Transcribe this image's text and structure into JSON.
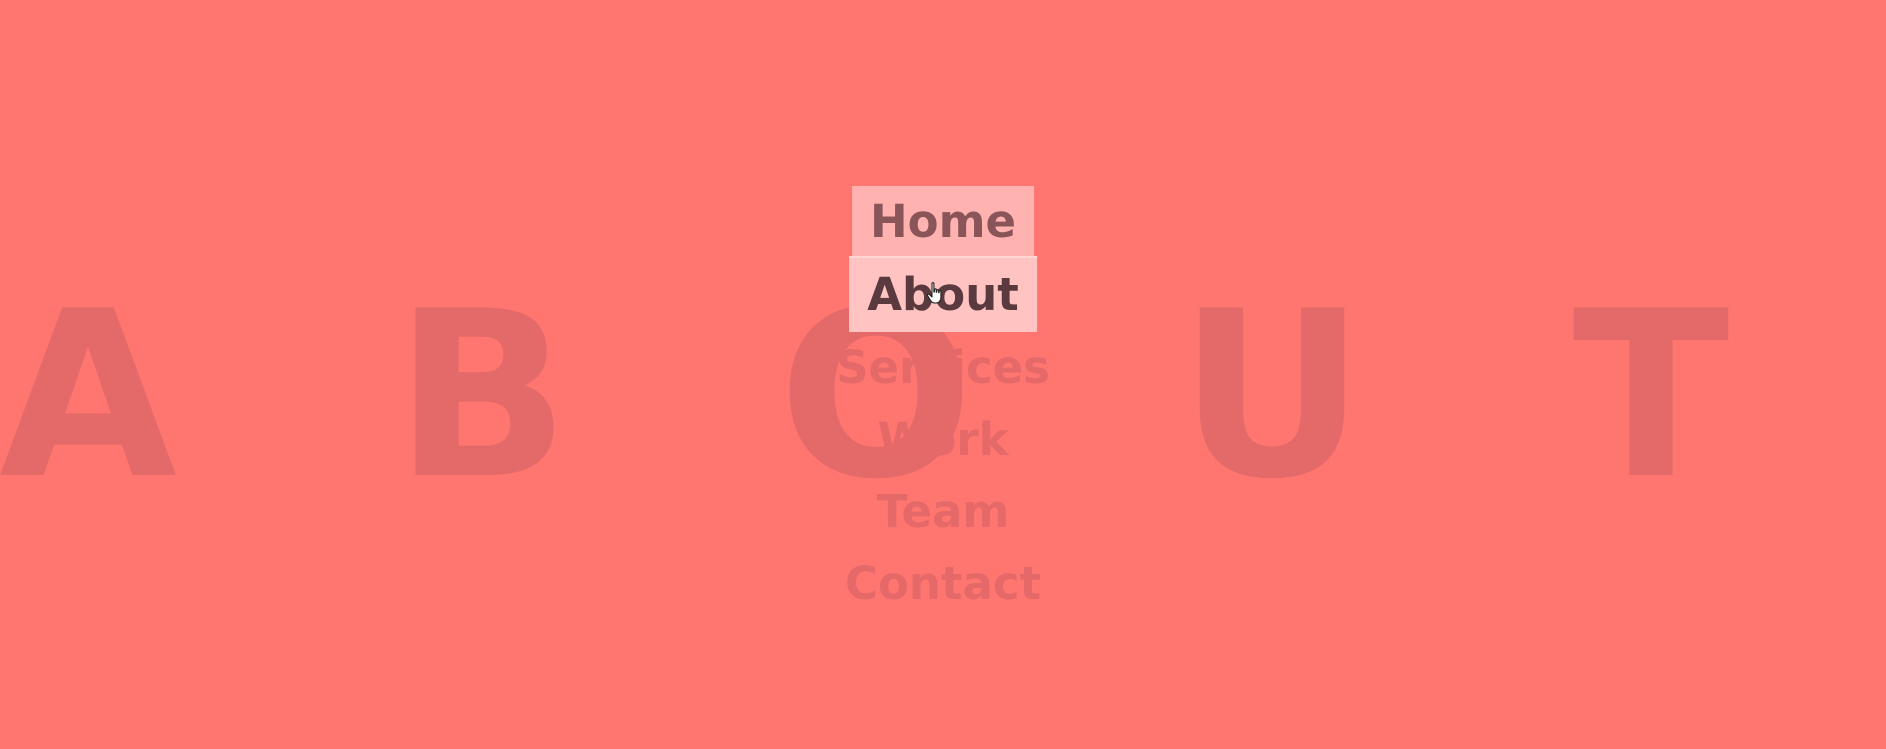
{
  "background_word": {
    "letters": [
      "A",
      "B",
      "O",
      "U",
      "T"
    ]
  },
  "menu": {
    "items": [
      {
        "label": "Home"
      },
      {
        "label": "About"
      },
      {
        "label": "Services"
      },
      {
        "label": "Work"
      },
      {
        "label": "Team"
      },
      {
        "label": "Contact"
      }
    ],
    "active_index": 1
  },
  "cursor": {
    "icon": "hand-pointer-icon"
  },
  "colors": {
    "background": "#ff7671",
    "background_letters": "#e36a68",
    "inactive_text": "#e46968",
    "active_bg": "#ffc4c2",
    "hover_bg": "#ffb2b0"
  }
}
